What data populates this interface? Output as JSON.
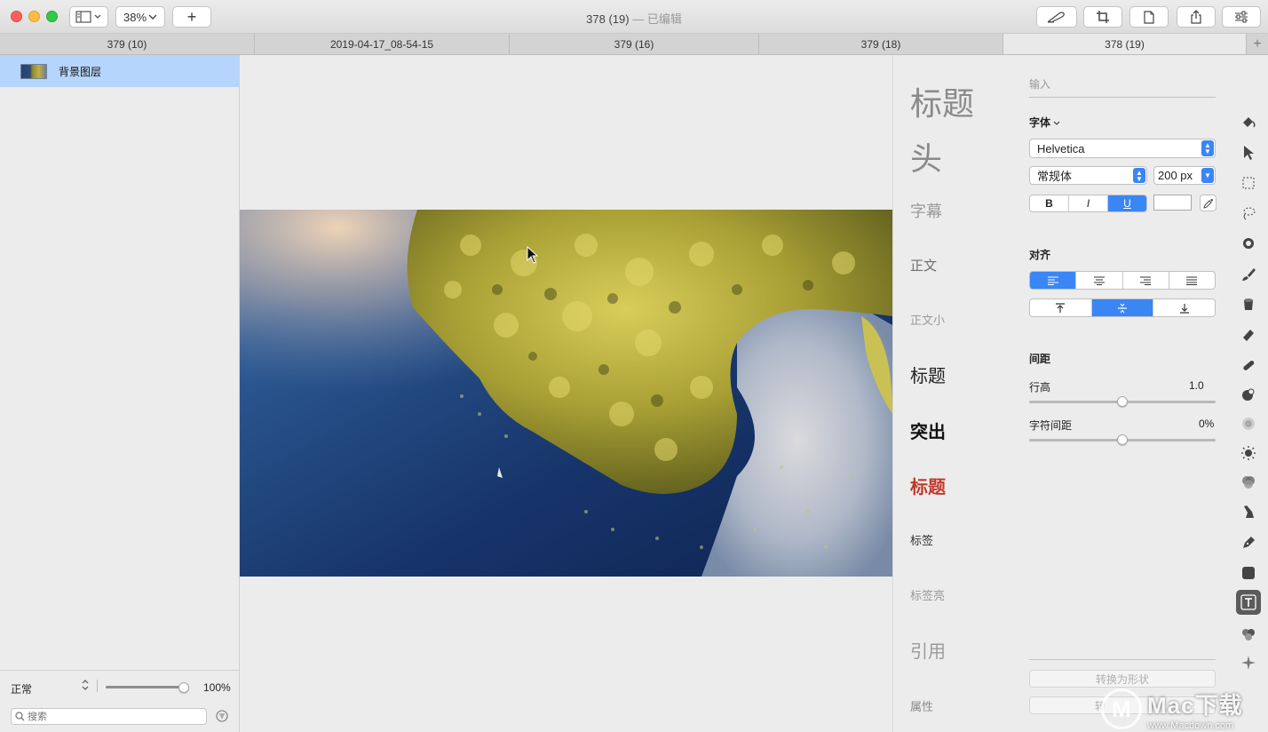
{
  "window": {
    "title": "378 (19)",
    "edited_suffix": "— 已编辑"
  },
  "toolbar": {
    "zoom": "38%",
    "add": "+"
  },
  "tabs": [
    {
      "label": "379 (10)",
      "active": false
    },
    {
      "label": "2019-04-17_08-54-15",
      "active": false
    },
    {
      "label": "379 (16)",
      "active": false
    },
    {
      "label": "379 (18)",
      "active": false
    },
    {
      "label": "378 (19)",
      "active": true
    }
  ],
  "tab_add": "+",
  "layers": {
    "items": [
      {
        "name": "背景图层",
        "selected": true
      }
    ],
    "blend_mode": "正常",
    "opacity": "100%",
    "opacity_fraction": 1.0,
    "search_placeholder": "搜索"
  },
  "text_styles": [
    {
      "label": "标题",
      "size": 36,
      "color": "#8a8a8a",
      "weight": "normal"
    },
    {
      "label": "头",
      "size": 36,
      "color": "#8a8a8a",
      "weight": "normal"
    },
    {
      "label": "字幕",
      "size": 18,
      "color": "#9a9a9a",
      "weight": "normal"
    },
    {
      "label": "正文",
      "size": 15,
      "color": "#6e6e6e",
      "weight": "normal"
    },
    {
      "label": "正文小",
      "size": 13,
      "color": "#9a9a9a",
      "weight": "normal"
    },
    {
      "label": "标题",
      "size": 20,
      "color": "#222222",
      "weight": "normal"
    },
    {
      "label": "突出",
      "size": 20,
      "color": "#111111",
      "weight": "bold"
    },
    {
      "label": "标题",
      "size": 20,
      "color": "#c0392b",
      "weight": "bold"
    },
    {
      "label": "标签",
      "size": 13,
      "color": "#333333",
      "weight": "normal"
    },
    {
      "label": "标签亮",
      "size": 13,
      "color": "#9a9a9a",
      "weight": "normal"
    },
    {
      "label": "引用",
      "size": 20,
      "color": "#9a9a9a",
      "weight": "normal"
    },
    {
      "label": "属性",
      "size": 13,
      "color": "#8a8a8a",
      "weight": "normal"
    }
  ],
  "inspector": {
    "input_placeholder": "输入",
    "font_section": "字体",
    "font_family": "Helvetica",
    "font_style": "常规体",
    "font_size": "200 px",
    "format_buttons": [
      {
        "label": "B",
        "on": false
      },
      {
        "label": "I",
        "on": false
      },
      {
        "label": "U",
        "on": true
      }
    ],
    "text_color": "#ffffff",
    "align_section": "对齐",
    "h_align": [
      {
        "name": "align-left",
        "on": true
      },
      {
        "name": "align-center",
        "on": false
      },
      {
        "name": "align-right",
        "on": false
      },
      {
        "name": "align-justify",
        "on": false
      }
    ],
    "v_align": [
      {
        "name": "align-top",
        "on": false
      },
      {
        "name": "align-middle",
        "on": true
      },
      {
        "name": "align-bottom",
        "on": false
      }
    ],
    "spacing_section": "间距",
    "line_height_label": "行高",
    "line_height_value": "1.0",
    "line_height_fraction": 0.5,
    "char_spacing_label": "字符间距",
    "char_spacing_value": "0%",
    "char_spacing_fraction": 0.5,
    "convert_shape": "转换为形状",
    "convert_partial": "转"
  },
  "tools": [
    "paint-bucket-icon",
    "arrow-select-icon",
    "marquee-select-icon",
    "lasso-icon",
    "magic-select-icon",
    "brush-icon",
    "bucket-fill-icon",
    "eraser-icon",
    "bandage-icon",
    "clone-icon",
    "blur-icon",
    "sun-icon",
    "color-adjust-icon",
    "smudge-icon",
    "pen-icon",
    "shape-icon",
    "text-tool-icon",
    "effects-icon",
    "sparkle-icon"
  ],
  "selected_tool": "text-tool-icon",
  "watermark": {
    "brand": "Mac下载",
    "url": "www.Macdown.com",
    "logo": "M"
  },
  "colors": {
    "accent": "#3a86f5",
    "selection": "#b5d5fc"
  }
}
